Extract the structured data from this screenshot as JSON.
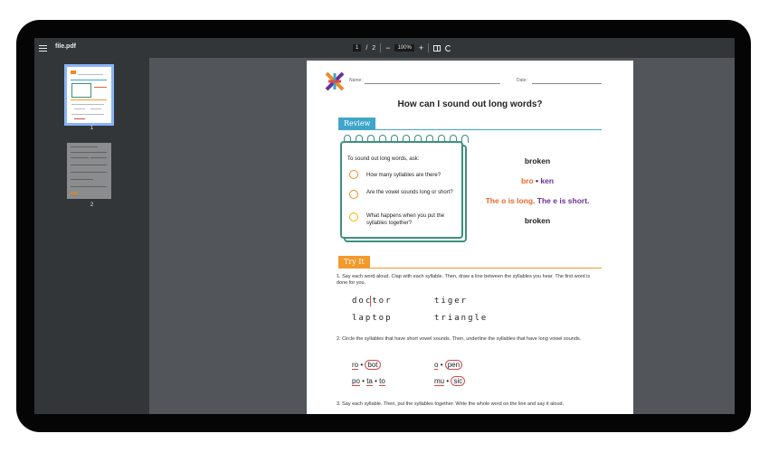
{
  "toolbar": {
    "file_name": "file.pdf",
    "current_page": "1",
    "page_separator": "/",
    "total_pages": "2",
    "zoom_out": "−",
    "zoom": "100%",
    "zoom_in": "+"
  },
  "thumbnails": [
    {
      "label": "1",
      "selected": true
    },
    {
      "label": "2",
      "selected": false
    }
  ],
  "worksheet": {
    "name_label": "Name:",
    "date_label": "Date:",
    "title": "How can I sound out long words?",
    "review_tag": "Review",
    "note_intro": "To sound out long words, ask:",
    "questions": [
      "How many syllables are there?",
      "Are the vowel sounds long or short?",
      "What happens when you put the syllables together?"
    ],
    "example": {
      "word": "broken",
      "syllable1": "bro",
      "dot": "•",
      "syllable2": "ken",
      "long_part": "The o is long.",
      "short_part": "The e is short.",
      "result": "broken"
    },
    "try_tag": "Try It",
    "q1": "1. Say each word aloud. Clap with each syllable. Then, draw a line between the syllables you hear. The first word is done for you.",
    "q1_words": [
      "doctor",
      "tiger",
      "laptop",
      "triangle"
    ],
    "q2": "2. Circle the syllables that have short vowel sounds. Then, underline the syllables that have long vowel sounds.",
    "q2_words": {
      "r1a": "ro",
      "r1b": "bot",
      "r1c": "o",
      "r1d": "pen",
      "r2a": "po",
      "r2b": "ta",
      "r2c": "to",
      "r2d": "mu",
      "r2e": "sic",
      "dot": "•"
    },
    "q3": "3. Say each syllable. Then, put the syllables together. Write the whole word on the line and say it aloud."
  },
  "colors": {
    "review_blue": "#3fa6c9",
    "try_orange": "#f39a2b",
    "syllable_orange": "#e8692c",
    "syllable_purple": "#6b2f98",
    "note_green": "#3c8f7f"
  }
}
